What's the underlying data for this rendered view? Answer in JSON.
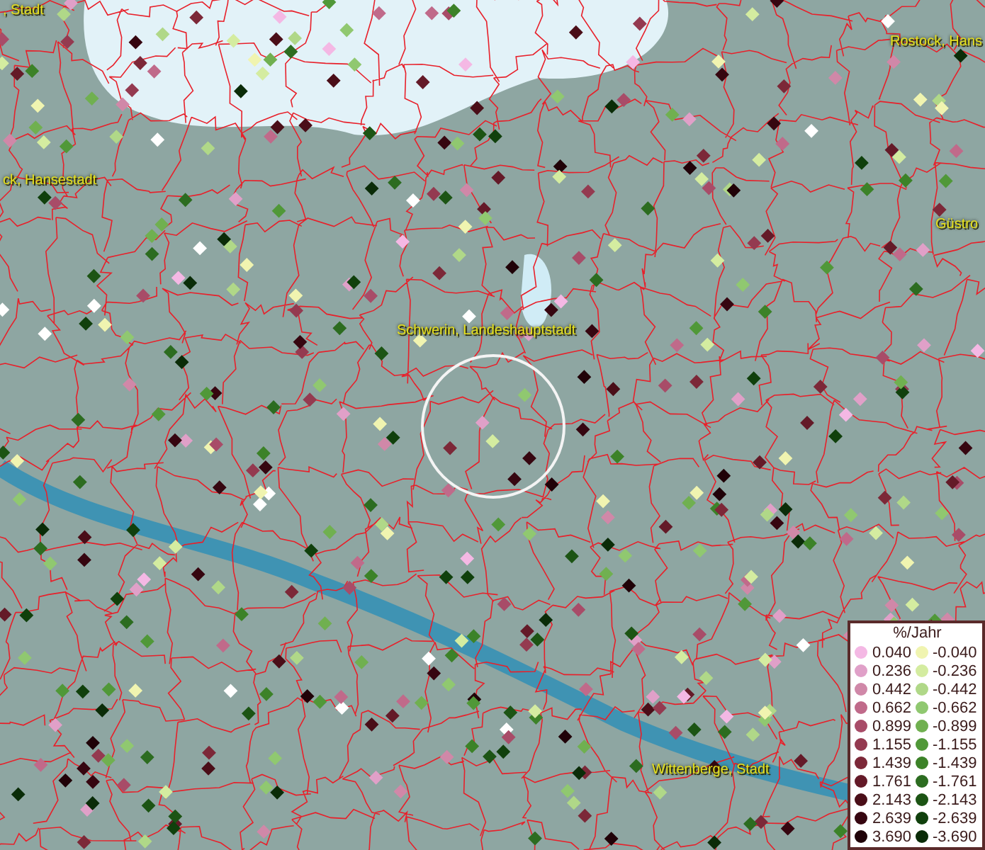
{
  "place_labels": [
    {
      "text": ", Stadt"
    },
    {
      "text": "ck, Hansestadt"
    },
    {
      "text": "Rostock, Hans"
    },
    {
      "text": "Güstro"
    },
    {
      "text": "Schwerin, Landeshauptstadt"
    },
    {
      "text": "Wittenberge, Stadt"
    }
  ],
  "legend": {
    "title": "%/Jahr",
    "positive": [
      {
        "label": "0.040",
        "color": "#f4b8e4"
      },
      {
        "label": "0.236",
        "color": "#e0a0c8"
      },
      {
        "label": "0.442",
        "color": "#d088a8"
      },
      {
        "label": "0.662",
        "color": "#c06a8a"
      },
      {
        "label": "0.899",
        "color": "#a84c68"
      },
      {
        "label": "1.155",
        "color": "#943a50"
      },
      {
        "label": "1.439",
        "color": "#7c2838"
      },
      {
        "label": "1.761",
        "color": "#641a28"
      },
      {
        "label": "2.143",
        "color": "#4a0e18"
      },
      {
        "label": "2.639",
        "color": "#360610"
      },
      {
        "label": "3.690",
        "color": "#200208"
      }
    ],
    "negative": [
      {
        "label": "-0.040",
        "color": "#f0f4b0"
      },
      {
        "label": "-0.236",
        "color": "#d4eca0"
      },
      {
        "label": "-0.442",
        "color": "#b0d888"
      },
      {
        "label": "-0.662",
        "color": "#90c870"
      },
      {
        "label": "-0.899",
        "color": "#70b050"
      },
      {
        "label": "-1.155",
        "color": "#509838"
      },
      {
        "label": "-1.439",
        "color": "#3c8228"
      },
      {
        "label": "-1.761",
        "color": "#2c6c20"
      },
      {
        "label": "-2.143",
        "color": "#1c5414"
      },
      {
        "label": "-2.639",
        "color": "#10400c"
      },
      {
        "label": "-3.690",
        "color": "#0a2c08"
      }
    ]
  }
}
